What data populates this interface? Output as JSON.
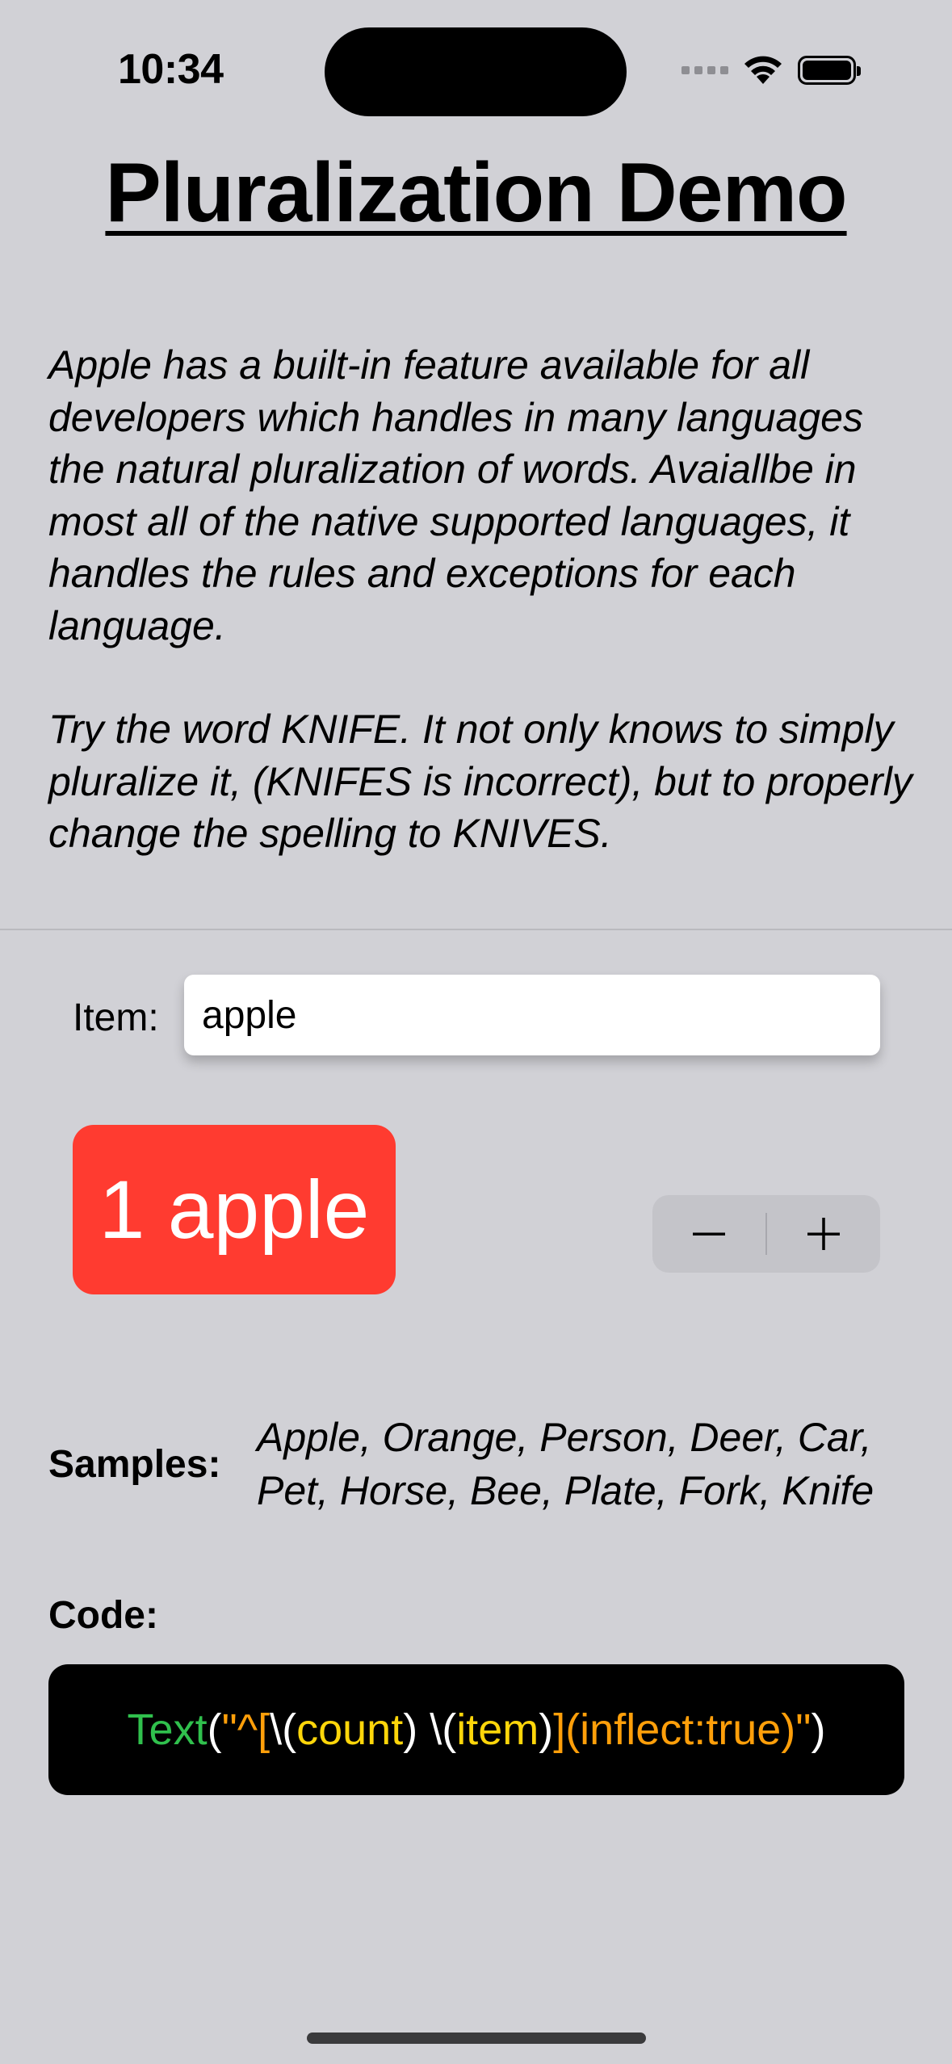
{
  "status_bar": {
    "time": "10:34",
    "icons": [
      "cellular-icon",
      "wifi-icon",
      "battery-icon"
    ]
  },
  "title": "Pluralization Demo",
  "description": {
    "paragraph1": "Apple has a built-in feature available for all developers which handles in many languages the natural pluralization of words. Avaiallbe in most all of the native supported languages, it handles the rules and exceptions for each language.",
    "paragraph2": "Try the word KNIFE. It not only knows to simply pluralize it, (KNIFES is incorrect), but to properly change the spelling to KNIVES."
  },
  "item": {
    "label": "Item:",
    "value": "apple"
  },
  "result": {
    "text": "1 apple",
    "count": 1,
    "color": "#ff3b30"
  },
  "stepper": {
    "decrement": "−",
    "increment": "+"
  },
  "samples": {
    "label": "Samples:",
    "text": "Apple, Orange, Person, Deer, Car, Pet, Horse, Bee, Plate, Fork, Knife"
  },
  "code": {
    "label": "Code:",
    "tokens": [
      {
        "text": "Text",
        "color": "#30c04d"
      },
      {
        "text": "(",
        "color": "#ffffff"
      },
      {
        "text": "\"^[",
        "color": "#ff9f0a"
      },
      {
        "text": "\\(",
        "color": "#ffffff"
      },
      {
        "text": "count",
        "color": "#ffd60a"
      },
      {
        "text": ") \\(",
        "color": "#ffffff"
      },
      {
        "text": "item",
        "color": "#ffd60a"
      },
      {
        "text": ")",
        "color": "#ffffff"
      },
      {
        "text": "](inflect:true)\"",
        "color": "#ff9f0a"
      },
      {
        "text": ")",
        "color": "#ffffff"
      }
    ]
  },
  "colors": {
    "background": "#d1d1d6",
    "accent": "#ff3b30",
    "code_background": "#000000"
  }
}
